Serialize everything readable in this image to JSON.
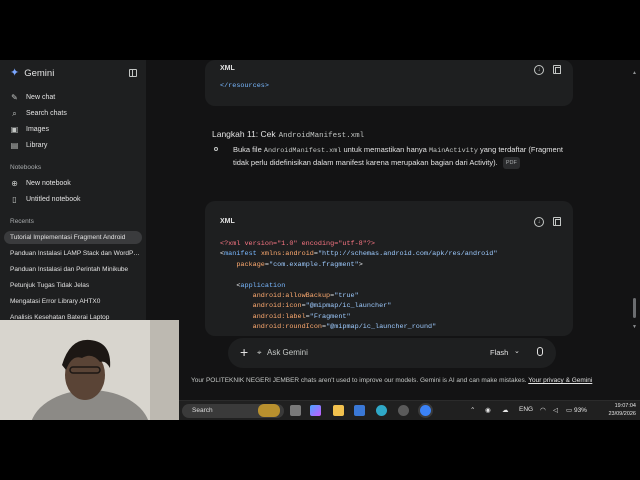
{
  "app": {
    "name": "Gemini"
  },
  "sidebar": {
    "items": [
      {
        "label": "New chat",
        "icon": "edit-icon"
      },
      {
        "label": "Search chats",
        "icon": "search-icon"
      },
      {
        "label": "Images",
        "icon": "image-icon"
      },
      {
        "label": "Library",
        "icon": "library-icon"
      }
    ],
    "notebooks_heading": "Notebooks",
    "notebooks": [
      {
        "label": "New notebook",
        "icon": "add-notebook-icon"
      },
      {
        "label": "Untitled notebook",
        "icon": "notebook-icon"
      }
    ],
    "recents_heading": "Recents",
    "recents": [
      "Tutorial Implementasi Fragment Android",
      "Panduan Instalasi LAMP Stack dan WordPress",
      "Panduan Instalasi dan Perintah Minikube",
      "Petunjuk Tugas Tidak Jelas",
      "Mengatasi Error Library AHTX0",
      "Analisis Kesehatan Baterai Laptop"
    ]
  },
  "main": {
    "code_block_1": {
      "label": "XML",
      "line": "</resources>"
    },
    "step": {
      "heading": "Langkah 11: Cek",
      "heading_code": "AndroidManifest.xml",
      "text_1": "Buka file",
      "code_1": "AndroidManifest.xml",
      "text_2": "untuk memastikan hanya",
      "code_2": "MainActivity",
      "text_3": "yang terdaftar (Fragment tidak perlu didefinisikan dalam manifest karena merupakan bagian dari Activity).",
      "chip": "PDF"
    },
    "code_block_2": {
      "label": "XML",
      "pi": "<?xml version=\"1.0\" encoding=\"utf-8\"?>",
      "manifest_tag": "manifest",
      "xmlns_attr": "xmlns:android",
      "xmlns_val": "\"http://schemas.android.com/apk/res/android\"",
      "package_attr": "package",
      "package_val": "\"com.example.fragment\"",
      "application_tag": "application",
      "attrs": [
        {
          "name": "android:allowBackup",
          "value": "\"true\""
        },
        {
          "name": "android:icon",
          "value": "\"@mipmap/ic_launcher\""
        },
        {
          "name": "android:label",
          "value": "\"Fragment\""
        },
        {
          "name": "android:roundIcon",
          "value": "\"@mipmap/ic_launcher_round\""
        }
      ]
    },
    "prompt": {
      "placeholder": "Ask Gemini",
      "mode": "Flash"
    },
    "disclaimer": {
      "text": "Your POLITEKNIK NEGERI JEMBER chats aren't used to improve our models. Gemini is AI and can make mistakes.",
      "link": "Your privacy & Gemini"
    }
  },
  "taskbar": {
    "search_label": "Search",
    "language": "ENG",
    "battery": "93%",
    "time": "19:07:04",
    "date": "23/09/2026"
  }
}
